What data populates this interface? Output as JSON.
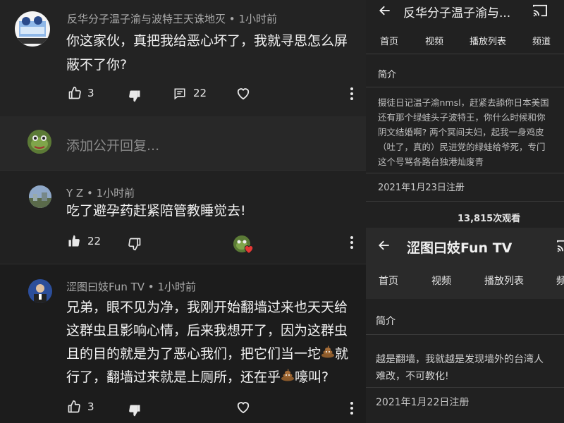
{
  "comments": [
    {
      "author": "反华分子温子渝与波特王天诛地灭",
      "time": "1小时前",
      "text_lines": [
        "你这家伙，真把我给恶心坏了，我就寻思怎么屏",
        "蔽不了你?"
      ],
      "likes": "3",
      "replies": "22"
    },
    {
      "author": "Y Z",
      "time": "1小时前",
      "text_lines": [
        "吃了避孕药赶紧陪管教睡觉去!"
      ],
      "likes": "22"
    },
    {
      "author": "涩图曰妓Fun TV",
      "time": "1小时前",
      "text_lines": [
        "兄弟，眼不见为净，我刚开始翻墙过来也天天给",
        "这群虫且影响心情，后来我想开了，因为这群虫",
        "且的目的就是为了恶心我们，把它们当一坨",
        "就",
        "行了，翻墙过来就是上厕所，还在乎",
        "嚎叫?"
      ],
      "likes": "3"
    }
  ],
  "reply_bar": {
    "placeholder": "添加公开回复..."
  },
  "meta_sep": "•",
  "panel_top": {
    "title": "反华分子温子渝与...",
    "tabs": [
      "首页",
      "视频",
      "播放列表",
      "频道"
    ],
    "section": "简介",
    "desc_lines": [
      "摄徒日记温子渝nmsl，赶紧去舔你日本美国",
      "还有那个绿蛙头子波特王，你什么时候和你",
      "阴文结婚啊? 两个冥间夫妇，起我一身鸡皮",
      "（吐了，真的）民进党的绿蛙给爷死，专门",
      "这个号骂各路台独港灿废青"
    ],
    "joined": "2021年1月23日注册",
    "views": "13,815次观看"
  },
  "panel_bottom": {
    "title": "涩图曰妓Fun TV",
    "tabs": [
      "首页",
      "视频",
      "播放列表",
      "频"
    ],
    "section": "简介",
    "desc_lines": [
      "越是翻墙，我就越是发现墙外的台湾人",
      "难改，不可教化!"
    ],
    "joined": "2021年1月22日注册"
  },
  "icons": {
    "like": "thumbs-up-icon",
    "dislike": "thumbs-down-icon",
    "reply": "comment-icon",
    "heart": "heart-icon",
    "more": "more-vertical-icon",
    "back": "arrow-back-icon",
    "cast": "cast-icon",
    "poop": "poop-emoji-icon",
    "creator_heart": "creator-heart-badge-icon"
  },
  "colors": {
    "background": "#181818",
    "heart_badge": "#e53935",
    "text": "#f1f1f1",
    "muted": "#aaaaaa"
  }
}
